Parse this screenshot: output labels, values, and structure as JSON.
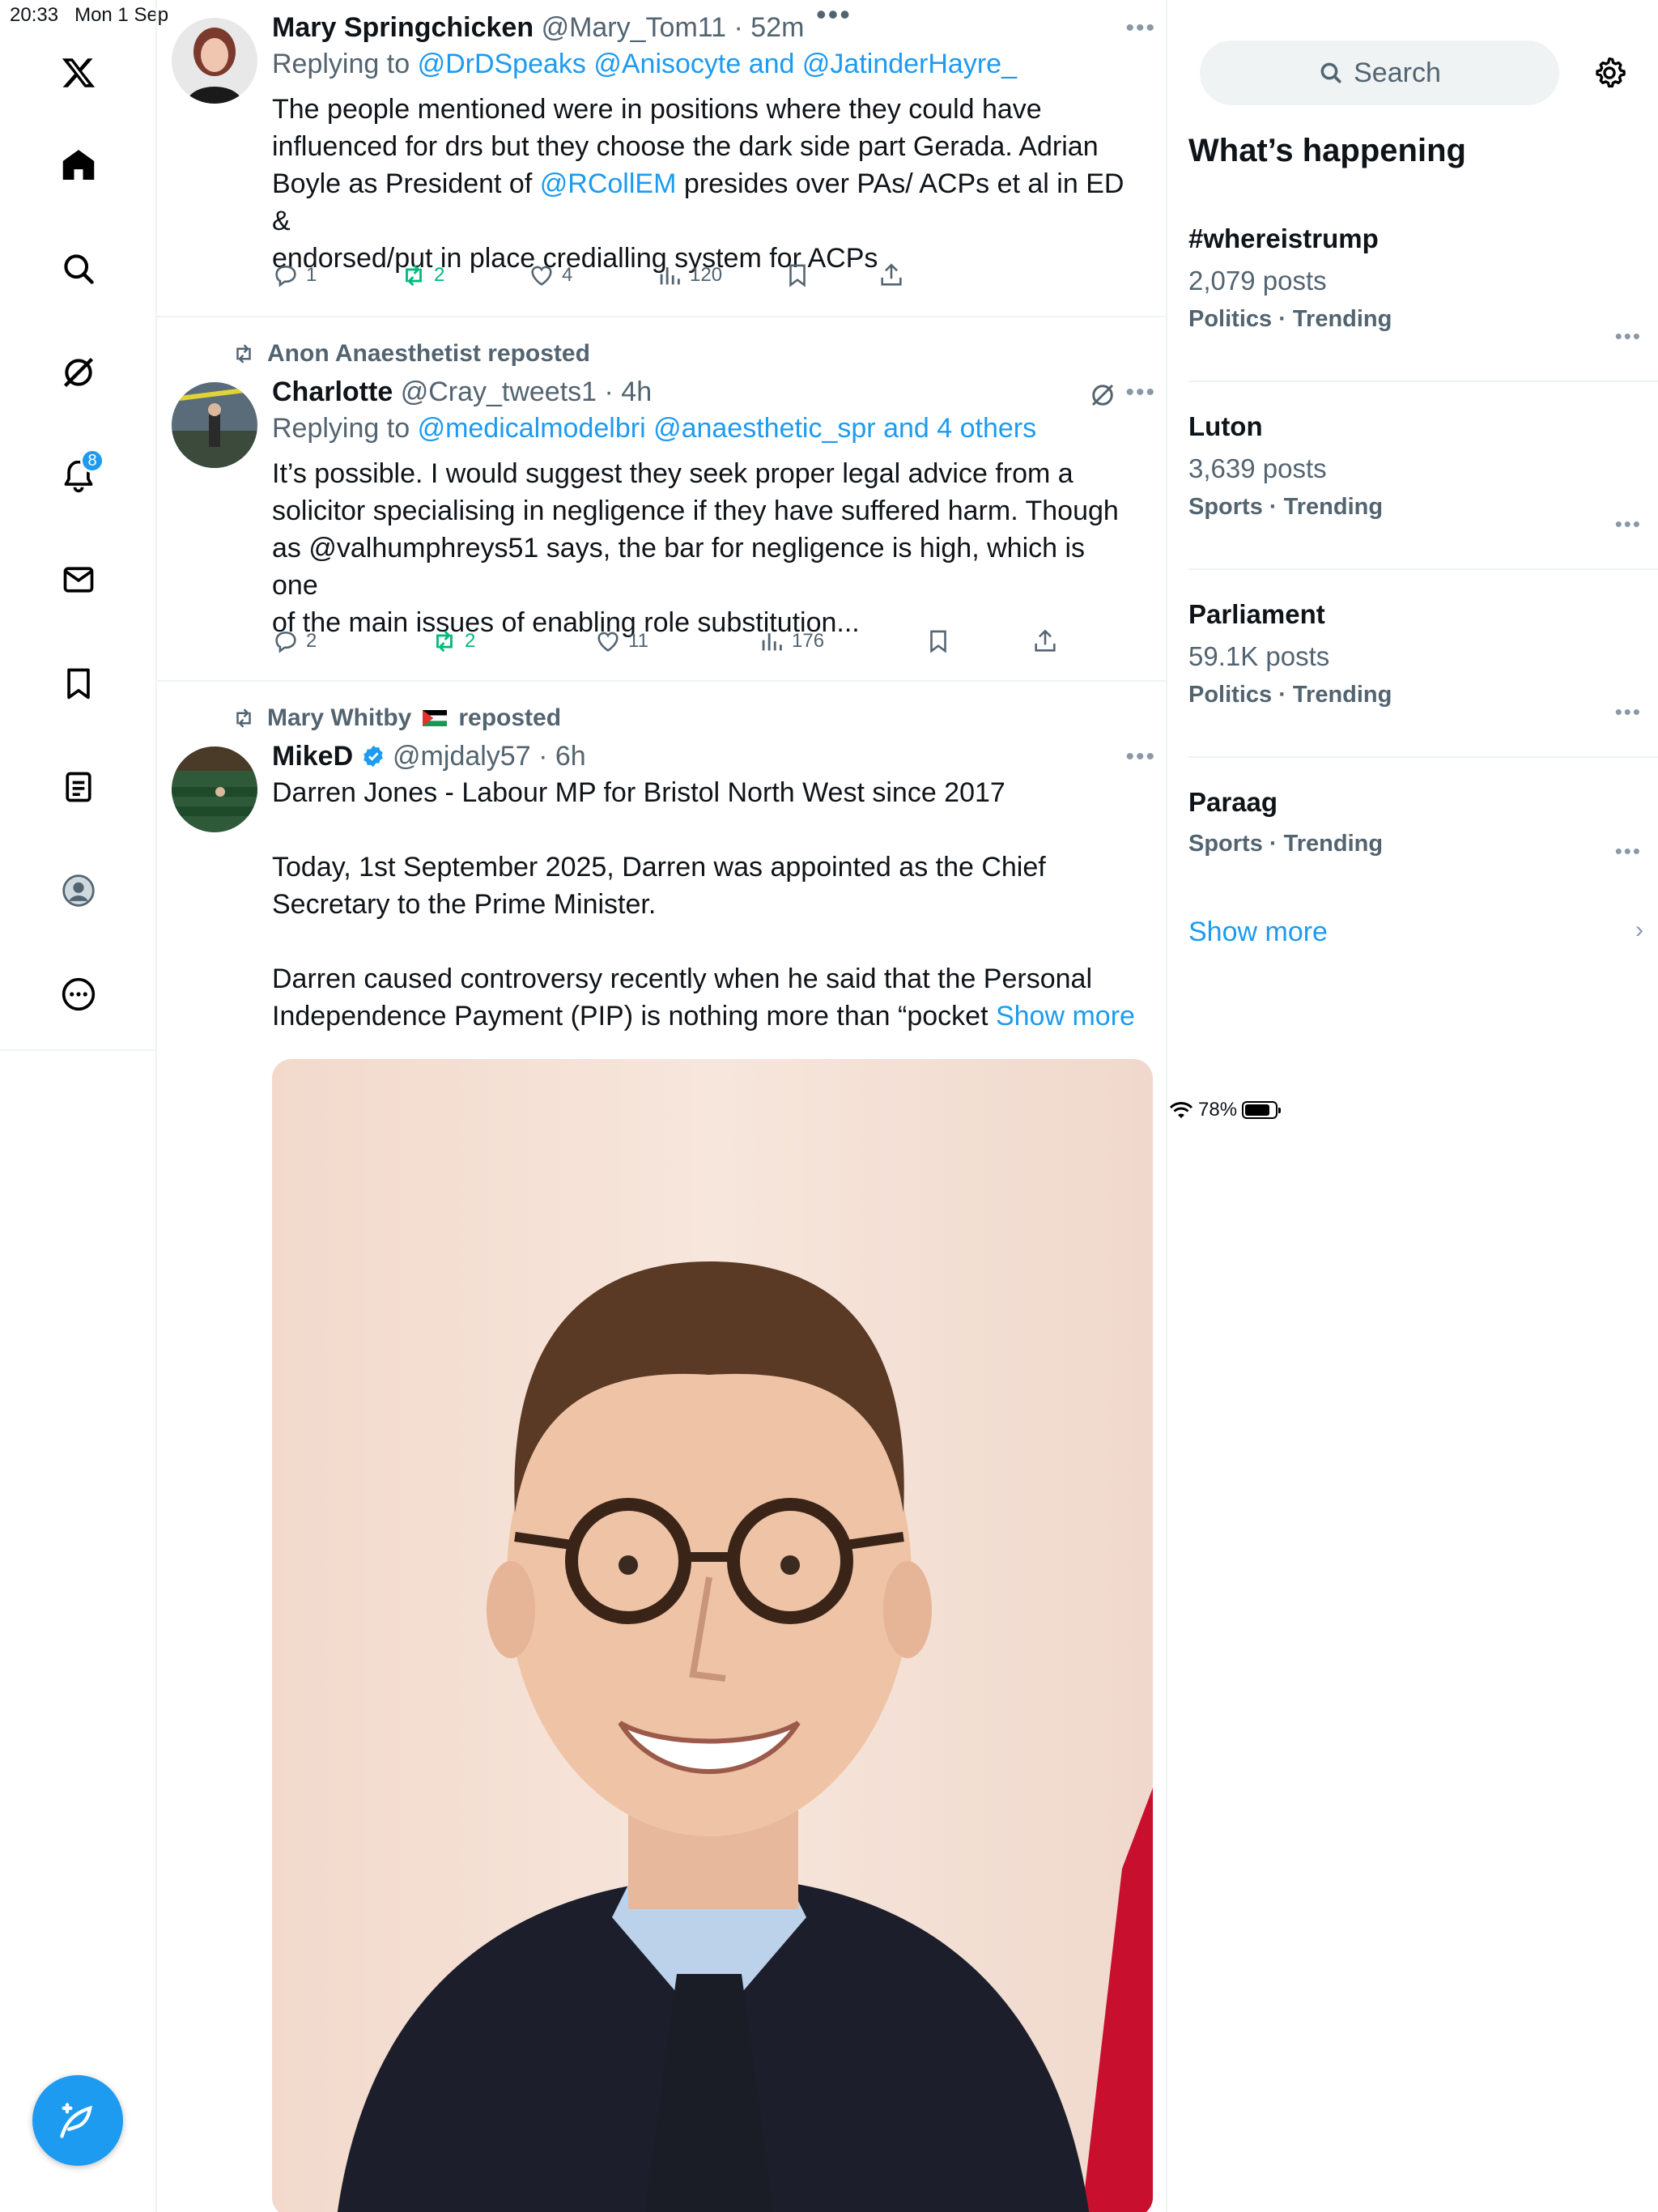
{
  "status": {
    "time": "20:33",
    "date": "Mon 1 Sep",
    "battery": "78%"
  },
  "nav": {
    "notification_count": "8"
  },
  "tweets": [
    {
      "name": "Mary Springchicken",
      "handle": "@Mary_Tom11",
      "time": "52m",
      "reply_prefix": "Replying to",
      "reply_to": "@DrDSpeaks @Anisocyte and @JatinderHayre_",
      "text_lines": [
        "The people mentioned were in positions where they could have",
        "influenced for drs but they choose the dark side part Gerada.   Adrian",
        "Boyle as President of ",
        "@RCollEM",
        " presides over PAs/ ACPs et al in ED &",
        "endorsed/put in place credialling system for ACPs"
      ],
      "counts": {
        "replies": "1",
        "reposts": "2",
        "likes": "4",
        "views": "120"
      }
    },
    {
      "repost_by": "Anon Anaesthetist reposted",
      "name": "Charlotte",
      "handle": "@Cray_tweets1",
      "time": "4h",
      "reply_prefix": "Replying to",
      "reply_to": "@medicalmodelbri @anaesthetic_spr and 4 others",
      "text_lines": [
        "It’s possible. I would suggest they seek proper legal advice from a",
        "solicitor specialising in negligence if they have suffered harm. Though",
        "as @valhumphreys51 says, the bar for negligence is high, which is one",
        "of the main issues of enabling role substitution..."
      ],
      "counts": {
        "replies": "2",
        "reposts": "2",
        "likes": "11",
        "views": "176"
      }
    },
    {
      "repost_by": "Mary Whitby",
      "repost_suffix": "reposted",
      "name": "MikeD",
      "handle": "@mjdaly57",
      "time": "6h",
      "text_lines": [
        "Darren Jones - Labour MP for Bristol North West since 2017",
        "Today, 1st September 2025, Darren was appointed as the Chief",
        "Secretary to the Prime Minister.",
        "Darren caused controversy recently when he said that the Personal",
        "Independence Payment (PIP) is nothing more than “pocket"
      ],
      "show_more": "Show more"
    }
  ],
  "sidebar": {
    "search_placeholder": "Search",
    "heading": "What’s happening",
    "trends": [
      {
        "title": "#whereistrump",
        "posts": "2,079 posts",
        "category": "Politics · Trending"
      },
      {
        "title": "Luton",
        "posts": "3,639 posts",
        "category": "Sports · Trending"
      },
      {
        "title": "Parliament",
        "posts": "59.1K posts",
        "category": "Politics · Trending"
      },
      {
        "title": "Paraag",
        "posts": "",
        "category": "Sports · Trending"
      }
    ],
    "show_more": "Show more"
  },
  "colors": {
    "accent": "#1d9bf0",
    "repost_green": "#00ba7c",
    "secondary": "#536471",
    "border": "#eff3f4"
  }
}
